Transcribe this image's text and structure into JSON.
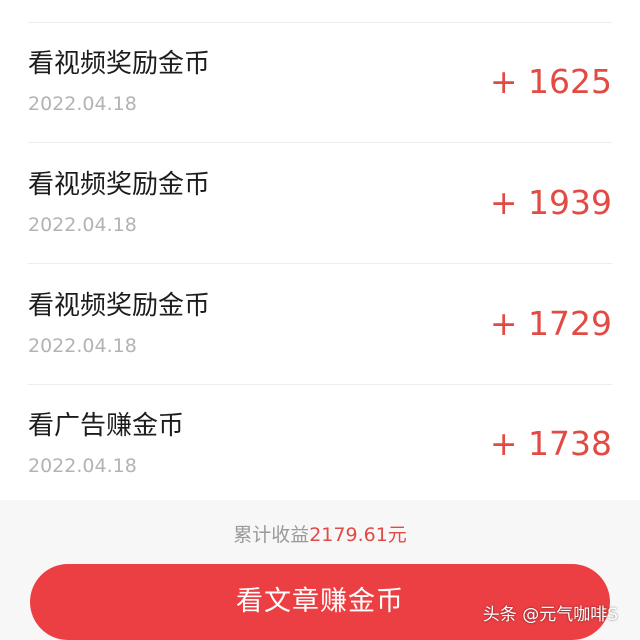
{
  "records": [
    {
      "title": "看视频奖励金币",
      "date": "2022.04.18",
      "amount": "+ 1625"
    },
    {
      "title": "看视频奖励金币",
      "date": "2022.04.18",
      "amount": "+ 1939"
    },
    {
      "title": "看视频奖励金币",
      "date": "2022.04.18",
      "amount": "+ 1729"
    },
    {
      "title": "看广告赚金币",
      "date": "2022.04.18",
      "amount": "+ 1738"
    }
  ],
  "summary": {
    "total_label": "累计收益",
    "total_value": "2179.61元"
  },
  "action": {
    "button_label": "看文章赚金币"
  },
  "watermark": "头条 @元气咖啡S",
  "colors": {
    "amount": "#e24a44",
    "button": "#ec3f43",
    "summary_background": "#f7f7f7"
  }
}
